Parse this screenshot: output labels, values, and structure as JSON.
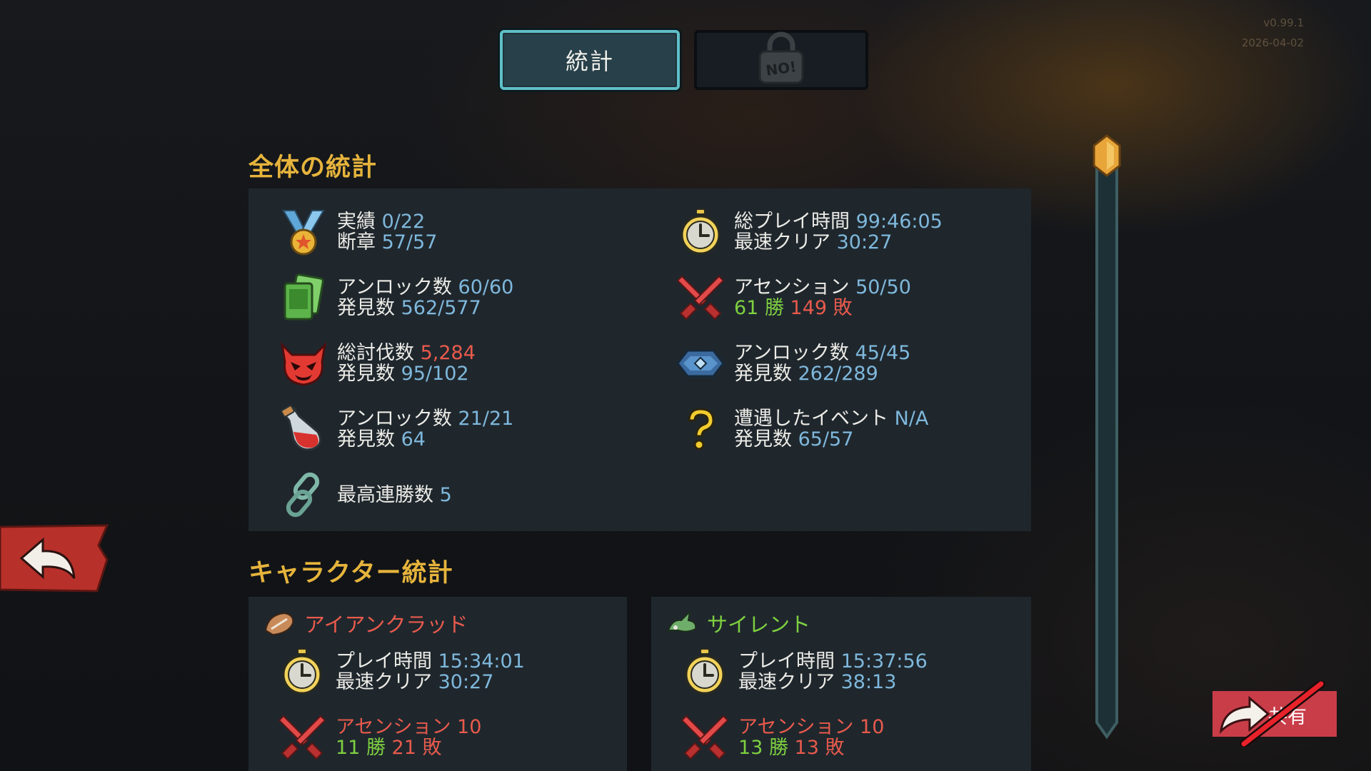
{
  "version": {
    "line1": "v0.99.1",
    "line2": "2026-04-02"
  },
  "tabs": {
    "stats_label": "統計",
    "locked_badge": "NO!"
  },
  "overall": {
    "heading": "全体の統計",
    "achievements": {
      "label1": "実績",
      "value1": "0/22",
      "label2": "断章",
      "value2": "57/57",
      "icon": "medal-icon"
    },
    "playtime": {
      "label1": "総プレイ時間",
      "value1": "99:46:05",
      "label2": "最速クリア",
      "value2": "30:27",
      "icon": "stopwatch-icon"
    },
    "cards": {
      "label1": "アンロック数",
      "value1": "60/60",
      "label2": "発見数",
      "value2": "562/577",
      "icon": "cards-icon"
    },
    "ascension": {
      "label1": "アセンション",
      "value1": "50/50",
      "wins": "61 勝",
      "losses": "149 敗",
      "icon": "crossed-swords-icon"
    },
    "monsters": {
      "label1": "総討伐数",
      "value1": "5,284",
      "label2": "発見数",
      "value2": "95/102",
      "icon": "demon-face-icon"
    },
    "relics": {
      "label1": "アンロック数",
      "value1": "45/45",
      "label2": "発見数",
      "value2": "262/289",
      "icon": "relic-icon"
    },
    "potions": {
      "label1": "アンロック数",
      "value1": "21/21",
      "label2": "発見数",
      "value2": "64",
      "icon": "potion-icon"
    },
    "events": {
      "label1": "遭遇したイベント",
      "value1": "N/A",
      "label2": "発見数",
      "value2": "65/57",
      "icon": "question-mark-icon"
    },
    "streak": {
      "label1": "最高連勝数",
      "value1": "5",
      "icon": "chain-icon"
    }
  },
  "character_heading": "キャラクター統計",
  "characters": [
    {
      "name": "アイアンクラッド",
      "play_label": "プレイ時間",
      "play_value": "15:34:01",
      "fast_label": "最速クリア",
      "fast_value": "30:27",
      "asc_label": "アセンション 10",
      "wins": "11 勝",
      "losses": "21 敗"
    },
    {
      "name": "サイレント",
      "play_label": "プレイ時間",
      "play_value": "15:37:56",
      "fast_label": "最速クリア",
      "fast_value": "38:13",
      "asc_label": "アセンション 10",
      "wins": "13 勝",
      "losses": "13 敗"
    }
  ],
  "share": {
    "label": "共有"
  },
  "colors": {
    "heading": "#e6b43c",
    "value_blue": "#7fb8dc",
    "value_red": "#e85a4c",
    "value_green": "#7ed040",
    "panel": "#1f272d",
    "tab_border": "#5fbfc8",
    "share_bg": "#c93d48"
  }
}
